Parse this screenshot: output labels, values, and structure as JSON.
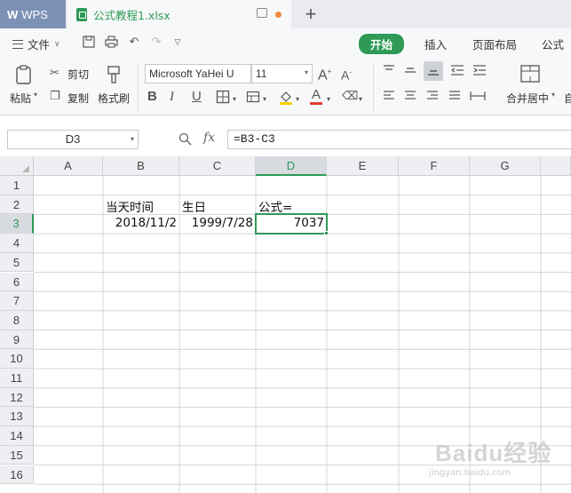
{
  "titlebar": {
    "app_label": "WPS",
    "file_tab_name": "公式教程1.xlsx",
    "new_tab": "+"
  },
  "menu": {
    "file_label": "文件",
    "tabs": [
      {
        "label": "开始",
        "active": true
      },
      {
        "label": "插入",
        "active": false
      },
      {
        "label": "页面布局",
        "active": false
      },
      {
        "label": "公式",
        "active": false
      }
    ]
  },
  "ribbon": {
    "paste_label": "粘贴",
    "cut_label": "剪切",
    "copy_label": "复制",
    "format_painter_label": "格式刷",
    "font_name": "Microsoft YaHei U",
    "font_size": "11",
    "bold": "B",
    "italic": "I",
    "underline": "U",
    "font_color_glyph": "A",
    "merge_label": "合并居中",
    "increase_font": "A",
    "decrease_font": "A",
    "auto_wrap_partial": "自"
  },
  "formula_bar": {
    "name_box": "D3",
    "fx_label": "fx",
    "formula": "=B3-C3"
  },
  "grid": {
    "columns": [
      "A",
      "B",
      "C",
      "D",
      "E",
      "F",
      "G"
    ],
    "rows": [
      "1",
      "2",
      "3",
      "4",
      "5",
      "6",
      "7",
      "8",
      "9",
      "10",
      "11",
      "12",
      "13",
      "14",
      "15",
      "16"
    ],
    "selected_column": "D",
    "selected_row": "3",
    "cells": {
      "B2": "当天时间",
      "C2": "生日",
      "D2": "公式=",
      "B3": "2018/11/2",
      "C3": "1999/7/28",
      "D3": "7037"
    }
  },
  "colors": {
    "accent": "#2e9a56",
    "wps_tab": "#7b90b5",
    "header_bg": "#eeeff2",
    "gridline": "#d4d4d4"
  },
  "watermark": {
    "brand": "Baidu经验",
    "sub": "jingyan.baidu.com"
  }
}
